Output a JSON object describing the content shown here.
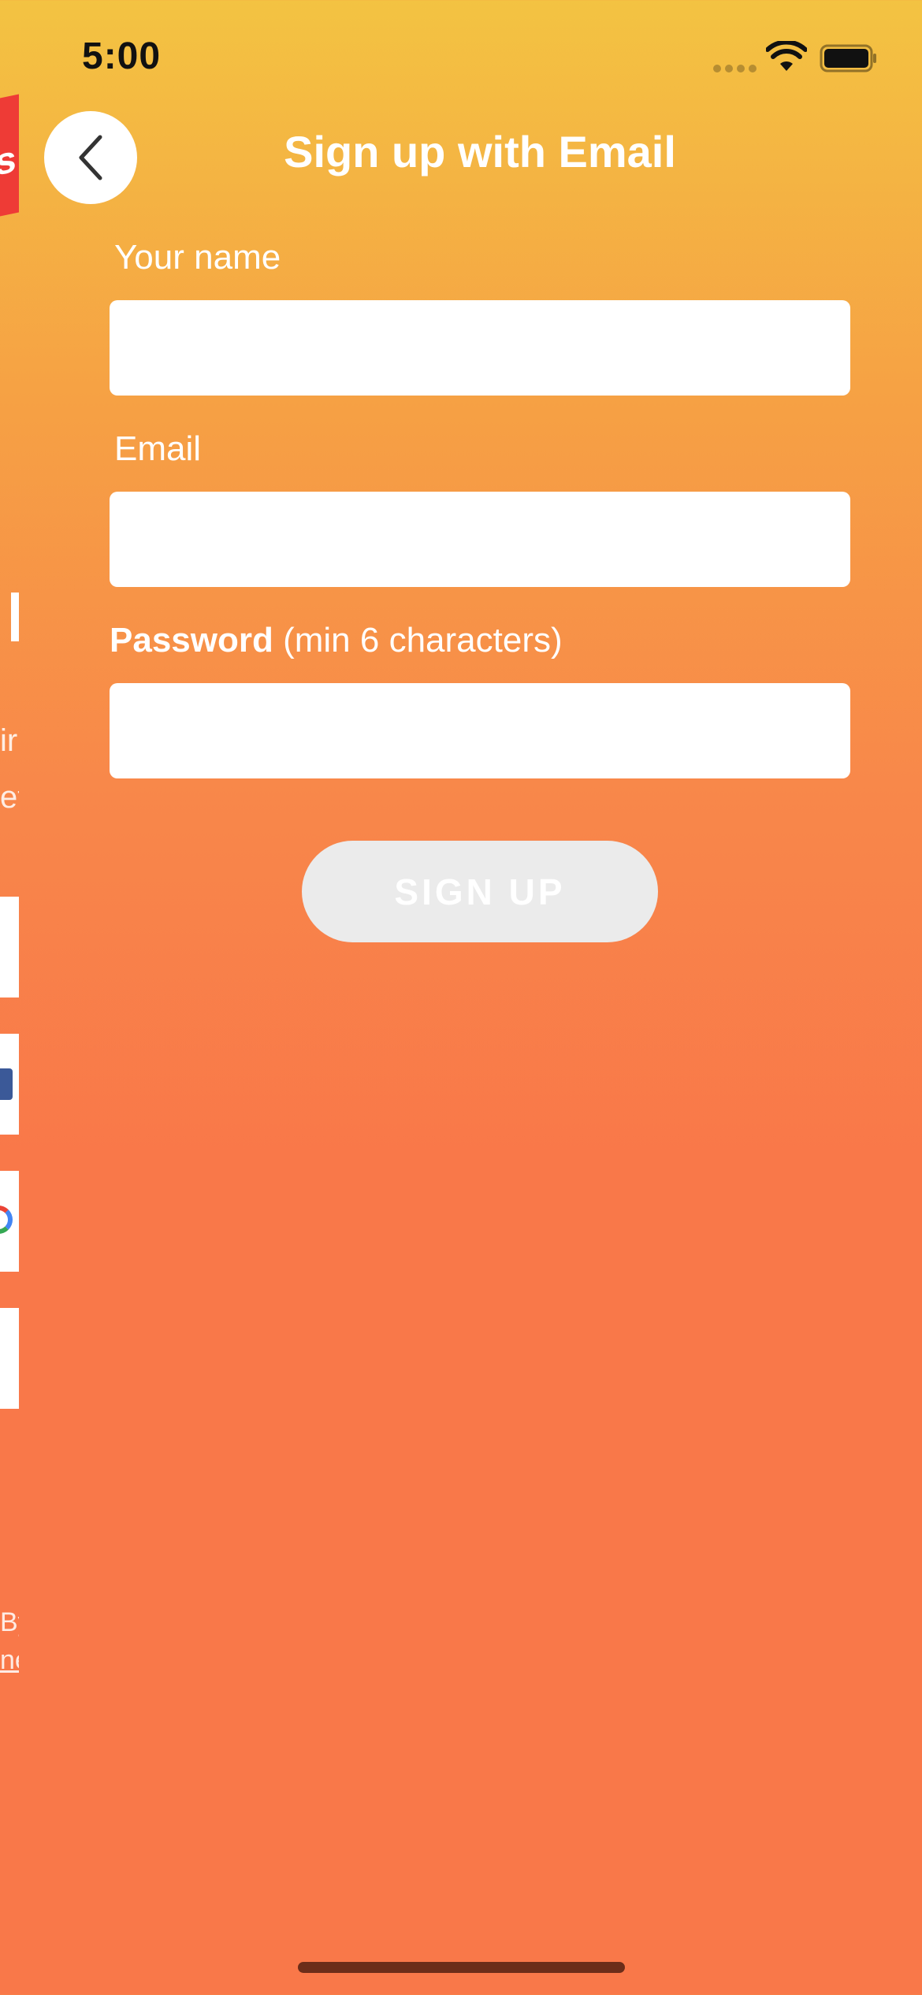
{
  "status_bar": {
    "time": "5:00"
  },
  "header": {
    "title": "Sign up with Email",
    "back_icon": "chevron-left-icon"
  },
  "form": {
    "name": {
      "label": "Your name",
      "value": "",
      "placeholder": ""
    },
    "email": {
      "label": "Email",
      "value": "",
      "placeholder": ""
    },
    "password": {
      "label_bold": "Password",
      "label_hint": " (min 6 characters)",
      "value": "",
      "placeholder": ""
    },
    "submit_label": "SIGN UP"
  },
  "background": {
    "peek_logo_text": "s",
    "peek_text_1": "ir",
    "peek_text_2": "et",
    "peek_footer_1": "By",
    "peek_footer_2": "ne"
  },
  "colors": {
    "gradient_top": "#F3C342",
    "gradient_bottom": "#F97849",
    "button_disabled": "#EBEBEB",
    "logo_red": "#EE3B36"
  }
}
